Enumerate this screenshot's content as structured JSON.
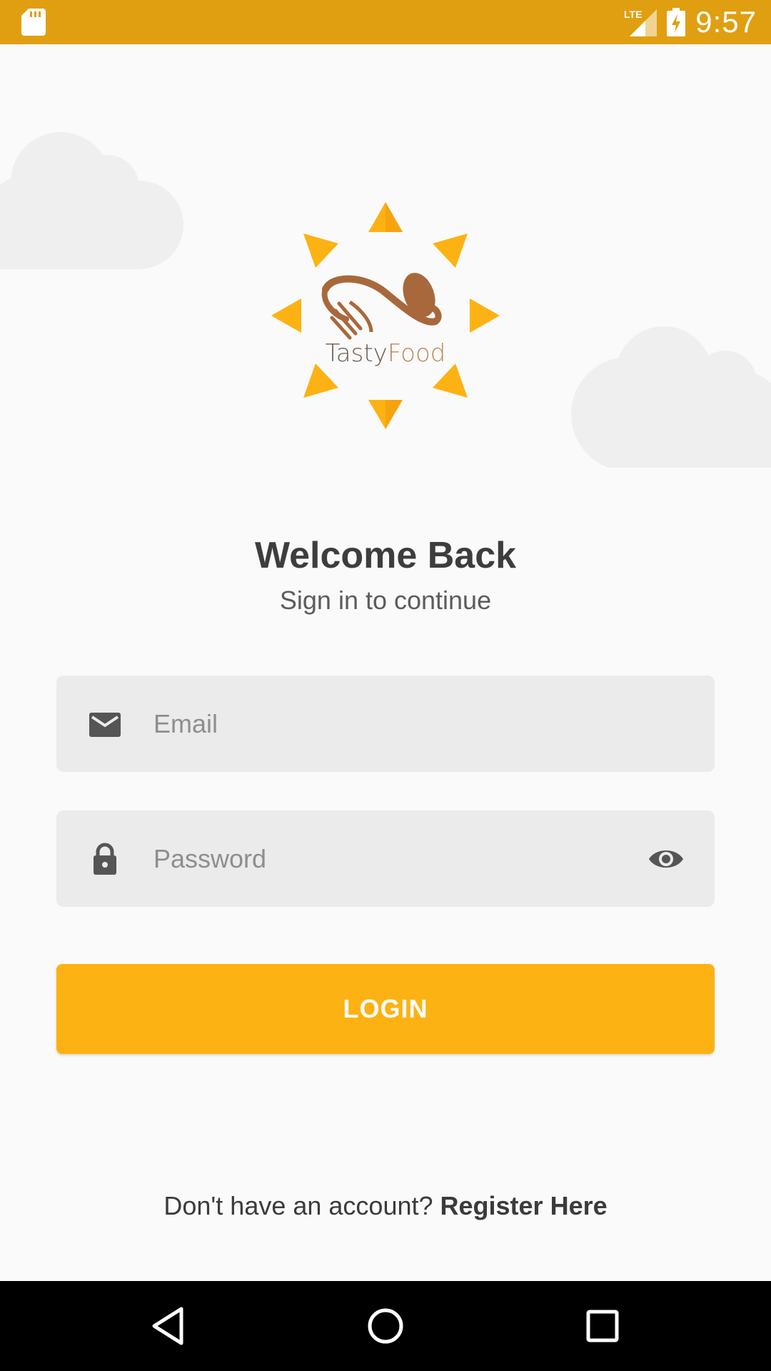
{
  "status_bar": {
    "time": "9:57",
    "network": "LTE",
    "icons": [
      "sd-card-icon",
      "lte-signal-icon",
      "battery-charging-icon"
    ],
    "background": "#e09f10"
  },
  "logo": {
    "brand_part1": "Tasty",
    "brand_part2": "Food",
    "ray_color": "#fdb213",
    "utensil_color": "#a8683c"
  },
  "header": {
    "title": "Welcome Back",
    "subtitle": "Sign in to continue"
  },
  "form": {
    "email": {
      "placeholder": "Email",
      "value": "",
      "icon": "email-icon"
    },
    "password": {
      "placeholder": "Password",
      "value": "",
      "icon": "lock-icon",
      "toggle_icon": "eye-icon"
    },
    "login_label": "LOGIN",
    "accent_color": "#fdb213"
  },
  "footer": {
    "prompt": "Don't have an account? ",
    "link": "Register Here"
  },
  "nav_bar": {
    "icons": [
      "back-icon",
      "home-icon",
      "recents-icon"
    ]
  }
}
